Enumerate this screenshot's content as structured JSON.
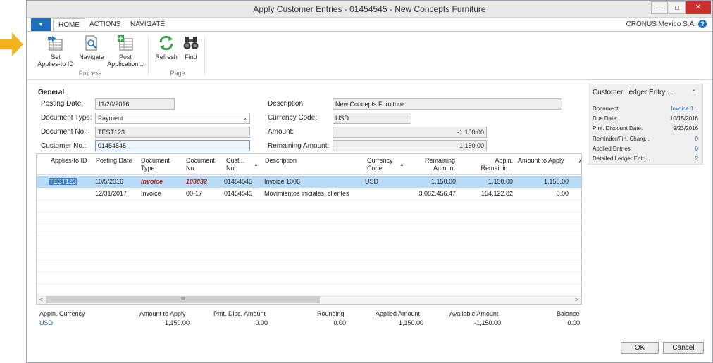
{
  "window": {
    "title": "Apply Customer Entries - 01454545 - New Concepts Furniture",
    "min_glyph": "—",
    "max_glyph": "□",
    "close_glyph": "✕"
  },
  "tabs": {
    "app_menu_glyph": "▼",
    "items": [
      "HOME",
      "ACTIONS",
      "NAVIGATE"
    ],
    "company": "CRONUS Mexico S.A.",
    "help_glyph": "?"
  },
  "ribbon": {
    "set_applies_line1": "Set",
    "set_applies_line2": "Applies-to ID",
    "navigate": "Navigate",
    "post_line1": "Post",
    "post_line2": "Application...",
    "refresh": "Refresh",
    "find": "Find",
    "group_process": "Process",
    "group_page": "Page"
  },
  "general": {
    "title": "General",
    "posting_date_label": "Posting Date:",
    "posting_date": "11/20/2016",
    "document_type_label": "Document Type:",
    "document_type": "Payment",
    "document_type_arrow": "⌄",
    "document_no_label": "Document No.:",
    "document_no": "TEST123",
    "customer_no_label": "Customer No.:",
    "customer_no": "01454545",
    "description_label": "Description:",
    "description": "New Concepts Furniture",
    "currency_code_label": "Currency Code:",
    "currency_code": "USD",
    "amount_label": "Amount:",
    "amount": "-1,150.00",
    "remaining_amount_label": "Remaining Amount:",
    "remaining_amount": "-1,150.00"
  },
  "grid": {
    "headers": {
      "applies_to_id": "Applies-to ID",
      "posting_date": "Posting Date",
      "document_type_1": "Document",
      "document_type_2": "Type",
      "document_no_1": "Document",
      "document_no_2": "No.",
      "cust_no_1": "Cust...",
      "cust_no_2": "No.",
      "description": "Description",
      "currency_code_1": "Currency",
      "currency_code_2": "Code",
      "remaining_1": "Remaining",
      "remaining_2": "Amount",
      "appln_remaining_1": "Appln.",
      "appln_remaining_2": "Remainin...",
      "amount_to_apply": "Amount to Apply",
      "overflow_col": "A",
      "sort_glyph": "▲"
    },
    "rows": [
      {
        "applies_to_id": "TEST123",
        "posting_date": "10/5/2016",
        "document_type": "Invoice",
        "document_no": "103032",
        "cust_no": "01454545",
        "description": "Invoice 1006",
        "currency_code": "USD",
        "remaining_amount": "1,150.00",
        "appln_remaining": "1,150.00",
        "amount_to_apply": "1,150.00"
      },
      {
        "applies_to_id": "",
        "posting_date": "12/31/2017",
        "document_type": "Invoice",
        "document_no": "00-17",
        "cust_no": "01454545",
        "description": "Movimientos iniciales, clientes",
        "currency_code": "",
        "remaining_amount": "3,082,456.47",
        "appln_remaining": "154,122.82",
        "amount_to_apply": "0.00"
      }
    ],
    "scroll_left_glyph": "<",
    "scroll_right_glyph": ">",
    "scroll_thumb_glyph": "III"
  },
  "totals": {
    "appln_currency_label": "Appln. Currency",
    "appln_currency": "USD",
    "amount_to_apply_label": "Amount to Apply",
    "amount_to_apply": "1,150.00",
    "pmt_disc_amount_label": "Pmt. Disc. Amount",
    "pmt_disc_amount": "0.00",
    "rounding_label": "Rounding",
    "rounding": "0.00",
    "applied_amount_label": "Applied Amount",
    "applied_amount": "1,150.00",
    "available_amount_label": "Available Amount",
    "available_amount": "-1,150.00",
    "balance_label": "Balance",
    "balance": "0.00"
  },
  "factbox": {
    "title": "Customer Ledger Entry ...",
    "chevron_glyph": "⌃",
    "document_label": "Document:",
    "document": "Invoice 1...",
    "due_date_label": "Due Date:",
    "due_date": "10/15/2016",
    "pmt_discount_date_label": "Pmt. Discount Date:",
    "pmt_discount_date": "9/23/2016",
    "reminder_label": "Reminder/Fin. Charg...",
    "reminder": "0",
    "applied_entries_label": "Applied Entries:",
    "applied_entries": "0",
    "detailed_ledger_label": "Detailed Ledger Entri...",
    "detailed_ledger": "2"
  },
  "buttons": {
    "ok": "OK",
    "cancel": "Cancel"
  },
  "colors": {
    "accent": "#1f6fc1",
    "selected_row": "#b9dbf5",
    "invoice_red": "#b4261d",
    "close_red": "#c9302c",
    "arrow_yellow": "#f3b21b"
  }
}
